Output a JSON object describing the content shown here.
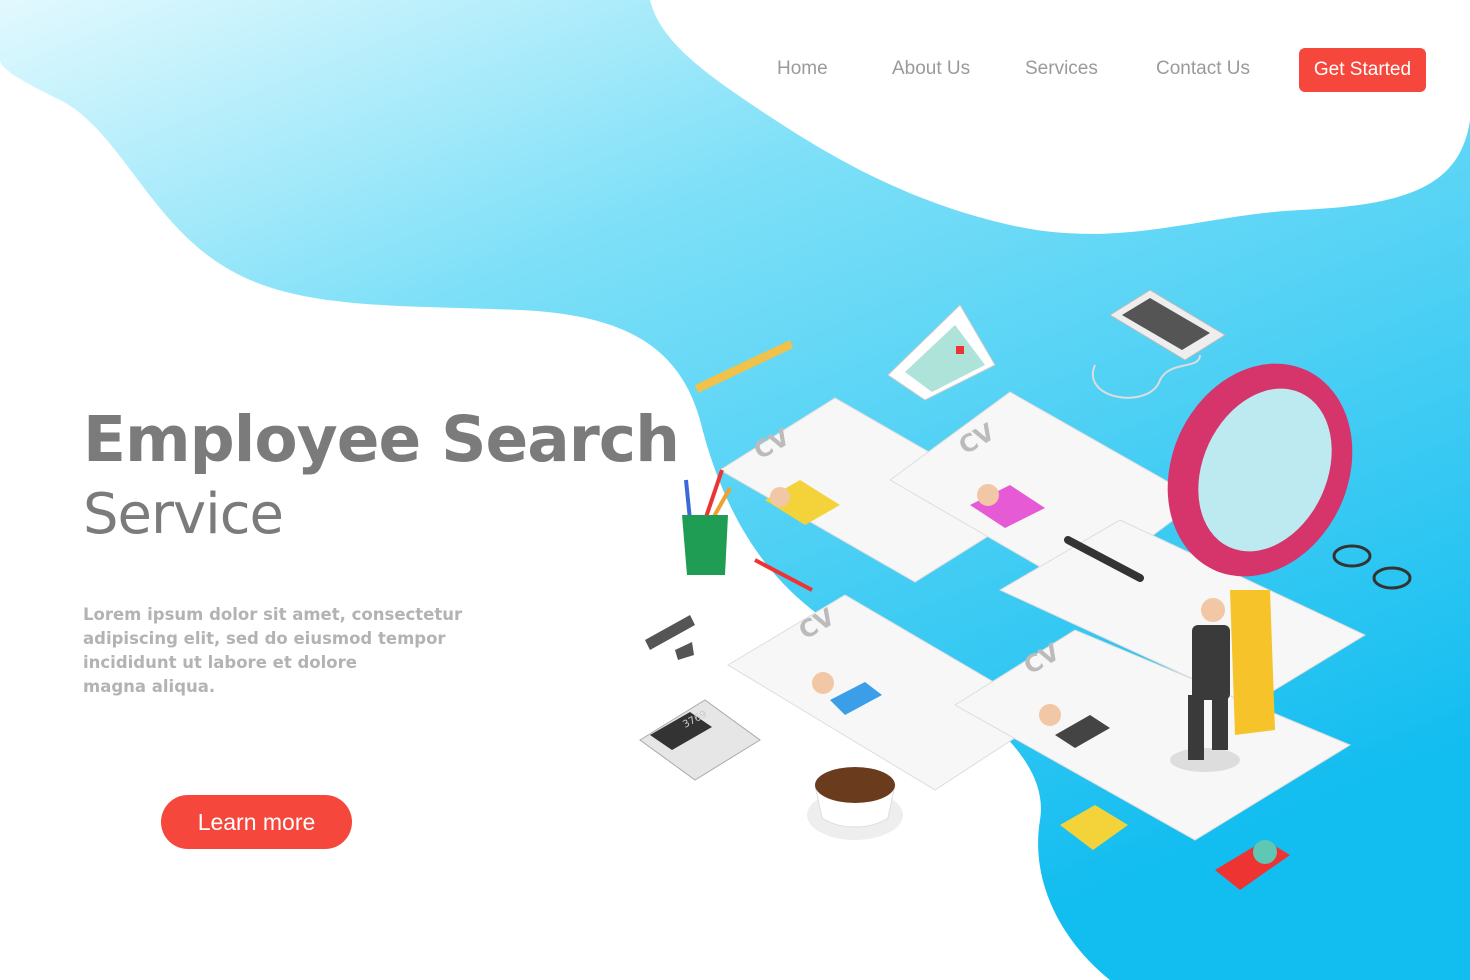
{
  "nav": {
    "links": [
      "Home",
      "About Us",
      "Services",
      "Contact Us"
    ],
    "cta_label": "Get Started"
  },
  "hero": {
    "title": "Employee Search",
    "subtitle": "Service",
    "description_lines": [
      "Lorem ipsum dolor sit amet, consectetur",
      "adipiscing elit, sed do eiusmod tempor",
      "incididunt ut labore et dolore",
      "magna aliqua."
    ],
    "button_label": "Learn more"
  },
  "illustration": {
    "cv_label": "CV",
    "calculator_display": "3769",
    "icons": [
      "ruler-icon",
      "calendar-icon",
      "smartphone-icon",
      "earphones-icon",
      "magnifier-icon",
      "pencil-cup-icon",
      "pen-icon",
      "glasses-icon",
      "marker-icon",
      "calculator-icon",
      "coffee-cup-icon",
      "sticky-notes-icon",
      "tape-dispenser-icon",
      "businessman-figure"
    ]
  },
  "colors": {
    "accent": "#f5473c",
    "blob_light": "#d6f6fd",
    "blob_dark": "#1ec6f2",
    "text": "#7b7b7b",
    "nav_text": "#9a9a9a"
  }
}
